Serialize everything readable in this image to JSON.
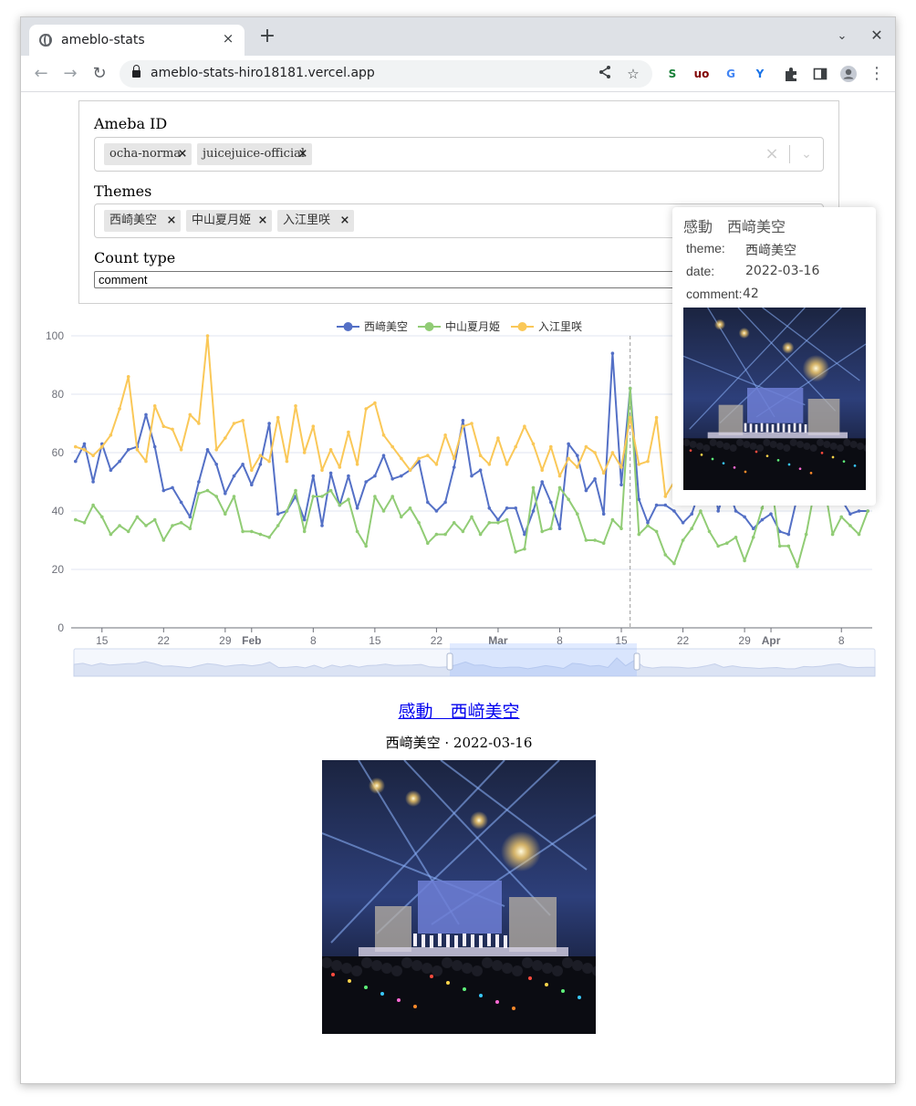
{
  "browser": {
    "tab_title": "ameblo-stats",
    "url": "ameblo-stats-hiro18181.vercel.app",
    "tab_close_icon": "×",
    "new_tab_icon": "+",
    "tab_menu_icon": "⌄",
    "window_close_icon": "✕",
    "extensions": [
      {
        "name": "s-extension-icon",
        "glyph": "S",
        "color": "#188038"
      },
      {
        "name": "ublock-icon",
        "glyph": "uo",
        "color": "#800000"
      },
      {
        "name": "translate-icon",
        "glyph": "G",
        "color": "#4285f4"
      },
      {
        "name": "bird-extension-icon",
        "glyph": "Y",
        "color": "#1a73e8"
      }
    ]
  },
  "form": {
    "ameba_id_label": "Ameba ID",
    "ameba_ids": [
      "ocha-norma",
      "juicejuice-official"
    ],
    "themes_label": "Themes",
    "themes": [
      "西崎美空",
      "中山夏月姫",
      "入江里咲"
    ],
    "count_type_label": "Count type",
    "count_type_value": "comment",
    "chip_remove_glyph": "×",
    "clear_glyph": "×",
    "chevron_glyph": "⌄"
  },
  "tooltip": {
    "title": "感動　西﨑美空",
    "theme_key": "theme:",
    "theme_val": "西﨑美空",
    "date_key": "date:",
    "date_val": "2022-03-16",
    "comment_key": "comment:",
    "comment_val": "42"
  },
  "post": {
    "title": "感動　西﨑美空",
    "subtitle": "西﨑美空 · 2022-03-16"
  },
  "chart_data": {
    "type": "line",
    "title": "",
    "xlabel": "",
    "ylabel": "",
    "ylim": [
      0,
      100
    ],
    "yticks": [
      0,
      20,
      40,
      60,
      80,
      100
    ],
    "x_ticks": [
      {
        "label": "15",
        "day": 3,
        "bold": false
      },
      {
        "label": "22",
        "day": 10,
        "bold": false
      },
      {
        "label": "29",
        "day": 17,
        "bold": false
      },
      {
        "label": "Feb",
        "day": 20,
        "bold": true
      },
      {
        "label": "8",
        "day": 27,
        "bold": false
      },
      {
        "label": "15",
        "day": 34,
        "bold": false
      },
      {
        "label": "22",
        "day": 41,
        "bold": false
      },
      {
        "label": "Mar",
        "day": 48,
        "bold": true
      },
      {
        "label": "8",
        "day": 55,
        "bold": false
      },
      {
        "label": "15",
        "day": 62,
        "bold": false
      },
      {
        "label": "22",
        "day": 69,
        "bold": false
      },
      {
        "label": "29",
        "day": 76,
        "bold": false
      },
      {
        "label": "Apr",
        "day": 79,
        "bold": true
      },
      {
        "label": "8",
        "day": 87,
        "bold": false
      }
    ],
    "x_start": "2022-01-12",
    "grid": true,
    "legend": "top-center",
    "hover_day": 63,
    "series": [
      {
        "name": "西﨑美空",
        "color": "#5470c6",
        "values": [
          57,
          63,
          50,
          63,
          54,
          57,
          61,
          62,
          73,
          62,
          47,
          48,
          43,
          38,
          50,
          61,
          56,
          46,
          52,
          56,
          49,
          56,
          70,
          39,
          40,
          45,
          37,
          52,
          35,
          53,
          42,
          52,
          41,
          50,
          52,
          59,
          51,
          52,
          54,
          57,
          43,
          40,
          43,
          55,
          71,
          52,
          54,
          41,
          37,
          41,
          41,
          32,
          40,
          50,
          43,
          34,
          63,
          59,
          47,
          51,
          39,
          94,
          49,
          82,
          44,
          36,
          42,
          42,
          40,
          36,
          39,
          48,
          60,
          40,
          49,
          40,
          38,
          34,
          37,
          39,
          33,
          32,
          45,
          43,
          47,
          56,
          60,
          44,
          39,
          40,
          40
        ]
      },
      {
        "name": "中山夏月姫",
        "color": "#91cc75",
        "values": [
          37,
          36,
          42,
          38,
          32,
          35,
          33,
          38,
          35,
          37,
          30,
          35,
          36,
          34,
          46,
          47,
          45,
          39,
          45,
          33,
          33,
          32,
          31,
          35,
          40,
          47,
          33,
          45,
          45,
          47,
          42,
          44,
          33,
          28,
          45,
          40,
          45,
          38,
          41,
          36,
          29,
          32,
          32,
          36,
          33,
          38,
          32,
          36,
          36,
          37,
          26,
          27,
          48,
          33,
          34,
          48,
          44,
          39,
          30,
          30,
          29,
          37,
          34,
          82,
          32,
          35,
          33,
          25,
          22,
          30,
          34,
          40,
          33,
          28,
          29,
          31,
          23,
          31,
          41,
          51,
          28,
          28,
          21,
          32,
          48,
          50,
          32,
          38,
          35,
          32,
          40
        ]
      },
      {
        "name": "入江里咲",
        "color": "#fac858",
        "values": [
          62,
          61,
          59,
          62,
          66,
          75,
          86,
          61,
          57,
          76,
          69,
          68,
          61,
          73,
          70,
          100,
          61,
          65,
          70,
          71,
          54,
          59,
          57,
          72,
          57,
          76,
          60,
          69,
          54,
          61,
          55,
          67,
          56,
          75,
          77,
          66,
          62,
          58,
          54,
          58,
          59,
          56,
          66,
          58,
          69,
          70,
          59,
          56,
          65,
          56,
          62,
          69,
          63,
          54,
          62,
          52,
          58,
          55,
          62,
          60,
          53,
          60,
          55,
          72,
          56,
          57,
          72,
          45,
          50,
          48,
          45,
          60,
          54,
          50,
          52,
          48,
          55,
          58,
          45,
          51,
          63,
          56,
          52,
          54,
          58,
          61,
          55,
          52,
          54,
          50,
          55
        ]
      }
    ]
  }
}
